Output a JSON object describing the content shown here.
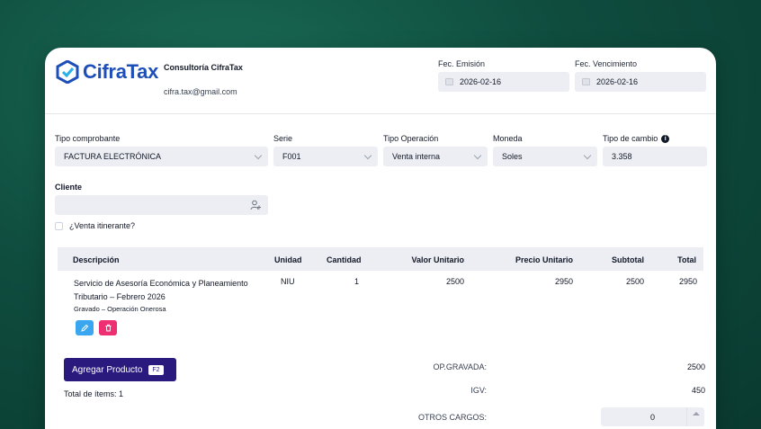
{
  "header": {
    "logo_text_a": "Cifra",
    "logo_text_b": "Tax",
    "company_name": "Consultoría CifraTax",
    "company_email": "cifra.tax@gmail.com",
    "emission": {
      "label": "Fec. Emisión",
      "value": "2026-02-16"
    },
    "due": {
      "label": "Fec. Vencimiento",
      "value": "2026-02-16"
    }
  },
  "form": {
    "tipo_comprobante": {
      "label": "Tipo comprobante",
      "value": "FACTURA ELECTRÓNICA"
    },
    "serie": {
      "label": "Serie",
      "value": "F001"
    },
    "tipo_operacion": {
      "label": "Tipo Operación",
      "value": "Venta interna"
    },
    "moneda": {
      "label": "Moneda",
      "value": "Soles"
    },
    "tipo_cambio": {
      "label": "Tipo de cambio",
      "value": "3.358"
    },
    "cliente": {
      "label": "Cliente",
      "value": ""
    },
    "itinerante_label": "¿Venta itinerante?"
  },
  "table": {
    "headers": {
      "descripcion": "Descripción",
      "unidad": "Unidad",
      "cantidad": "Cantidad",
      "valor_unitario": "Valor Unitario",
      "precio_unitario": "Precio Unitario",
      "subtotal": "Subtotal",
      "total": "Total"
    },
    "rows": [
      {
        "descripcion": "Servicio de Asesoría Económica y Planeamiento Tributario – Febrero 2026",
        "detalle": "Gravado – Operación Onerosa",
        "unidad": "NIU",
        "cantidad": "1",
        "valor_unitario": "2500",
        "precio_unitario": "2950",
        "subtotal": "2500",
        "total": "2950"
      }
    ]
  },
  "footer": {
    "add_button": "Agregar Producto",
    "add_shortcut": "F2",
    "total_items": "Total de ítems: 1",
    "op_gravada": {
      "label": "OP.GRAVADA:",
      "value": "2500"
    },
    "igv": {
      "label": "IGV:",
      "value": "450"
    },
    "otros_cargos": {
      "label": "OTROS CARGOS:",
      "value": "0"
    }
  },
  "colors": {
    "primary": "#2b1a7d",
    "edit": "#3aa6f0",
    "delete": "#ee2f72",
    "brand": "#1e4fb8",
    "background": "#0f4d3f"
  }
}
